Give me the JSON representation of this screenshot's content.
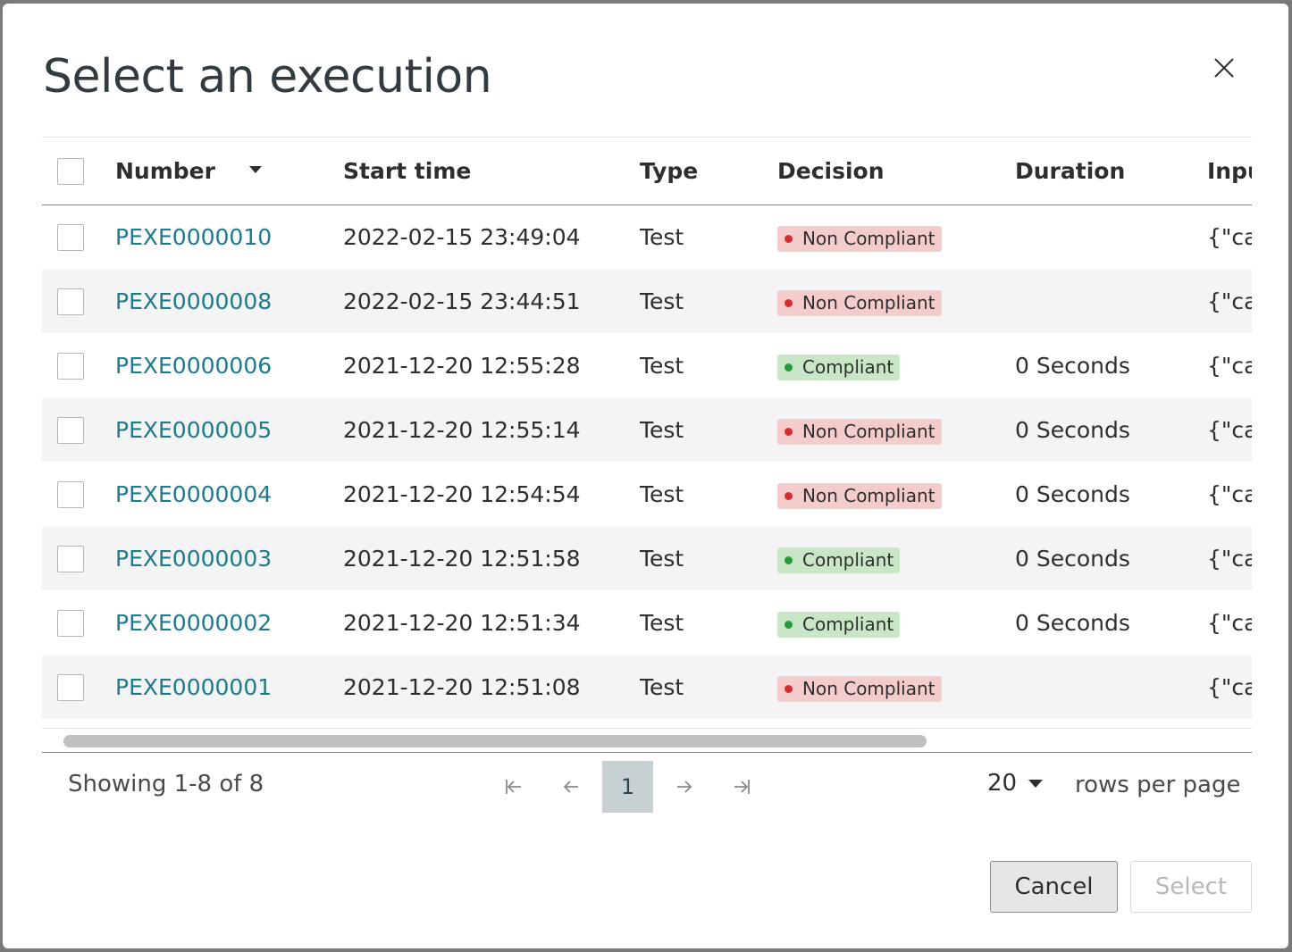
{
  "dialog": {
    "title": "Select an execution",
    "close_icon": "close-icon"
  },
  "table": {
    "columns": {
      "number": "Number",
      "start_time": "Start time",
      "type": "Type",
      "decision": "Decision",
      "duration": "Duration",
      "input": "Inpu"
    },
    "sort": {
      "column": "number",
      "direction": "descending",
      "icon": "sort-down-icon"
    },
    "rows": [
      {
        "number": "PEXE0000010",
        "start_time": "2022-02-15 23:49:04",
        "type": "Test",
        "decision": "Non Compliant",
        "duration": "",
        "input": "{\"cal"
      },
      {
        "number": "PEXE0000008",
        "start_time": "2022-02-15 23:44:51",
        "type": "Test",
        "decision": "Non Compliant",
        "duration": "",
        "input": "{\"cal"
      },
      {
        "number": "PEXE0000006",
        "start_time": "2021-12-20 12:55:28",
        "type": "Test",
        "decision": "Compliant",
        "duration": "0 Seconds",
        "input": "{\"cal"
      },
      {
        "number": "PEXE0000005",
        "start_time": "2021-12-20 12:55:14",
        "type": "Test",
        "decision": "Non Compliant",
        "duration": "0 Seconds",
        "input": "{\"cal"
      },
      {
        "number": "PEXE0000004",
        "start_time": "2021-12-20 12:54:54",
        "type": "Test",
        "decision": "Non Compliant",
        "duration": "0 Seconds",
        "input": "{\"cal"
      },
      {
        "number": "PEXE0000003",
        "start_time": "2021-12-20 12:51:58",
        "type": "Test",
        "decision": "Compliant",
        "duration": "0 Seconds",
        "input": "{\"cal"
      },
      {
        "number": "PEXE0000002",
        "start_time": "2021-12-20 12:51:34",
        "type": "Test",
        "decision": "Compliant",
        "duration": "0 Seconds",
        "input": "{\"cal"
      },
      {
        "number": "PEXE0000001",
        "start_time": "2021-12-20 12:51:08",
        "type": "Test",
        "decision": "Non Compliant",
        "duration": "",
        "input": "{\"cal"
      }
    ]
  },
  "decision_colors": {
    "Non Compliant": {
      "bg": "#f4cccc",
      "dot": "#d62d2d"
    },
    "Compliant": {
      "bg": "#c9e6c6",
      "dot": "#2a9a3a"
    }
  },
  "pagination": {
    "showing": "Showing 1-8 of 8",
    "current_page": "1",
    "rows_per_page_value": "20",
    "rows_per_page_label": "rows per page"
  },
  "footer": {
    "cancel_label": "Cancel",
    "select_label": "Select"
  }
}
